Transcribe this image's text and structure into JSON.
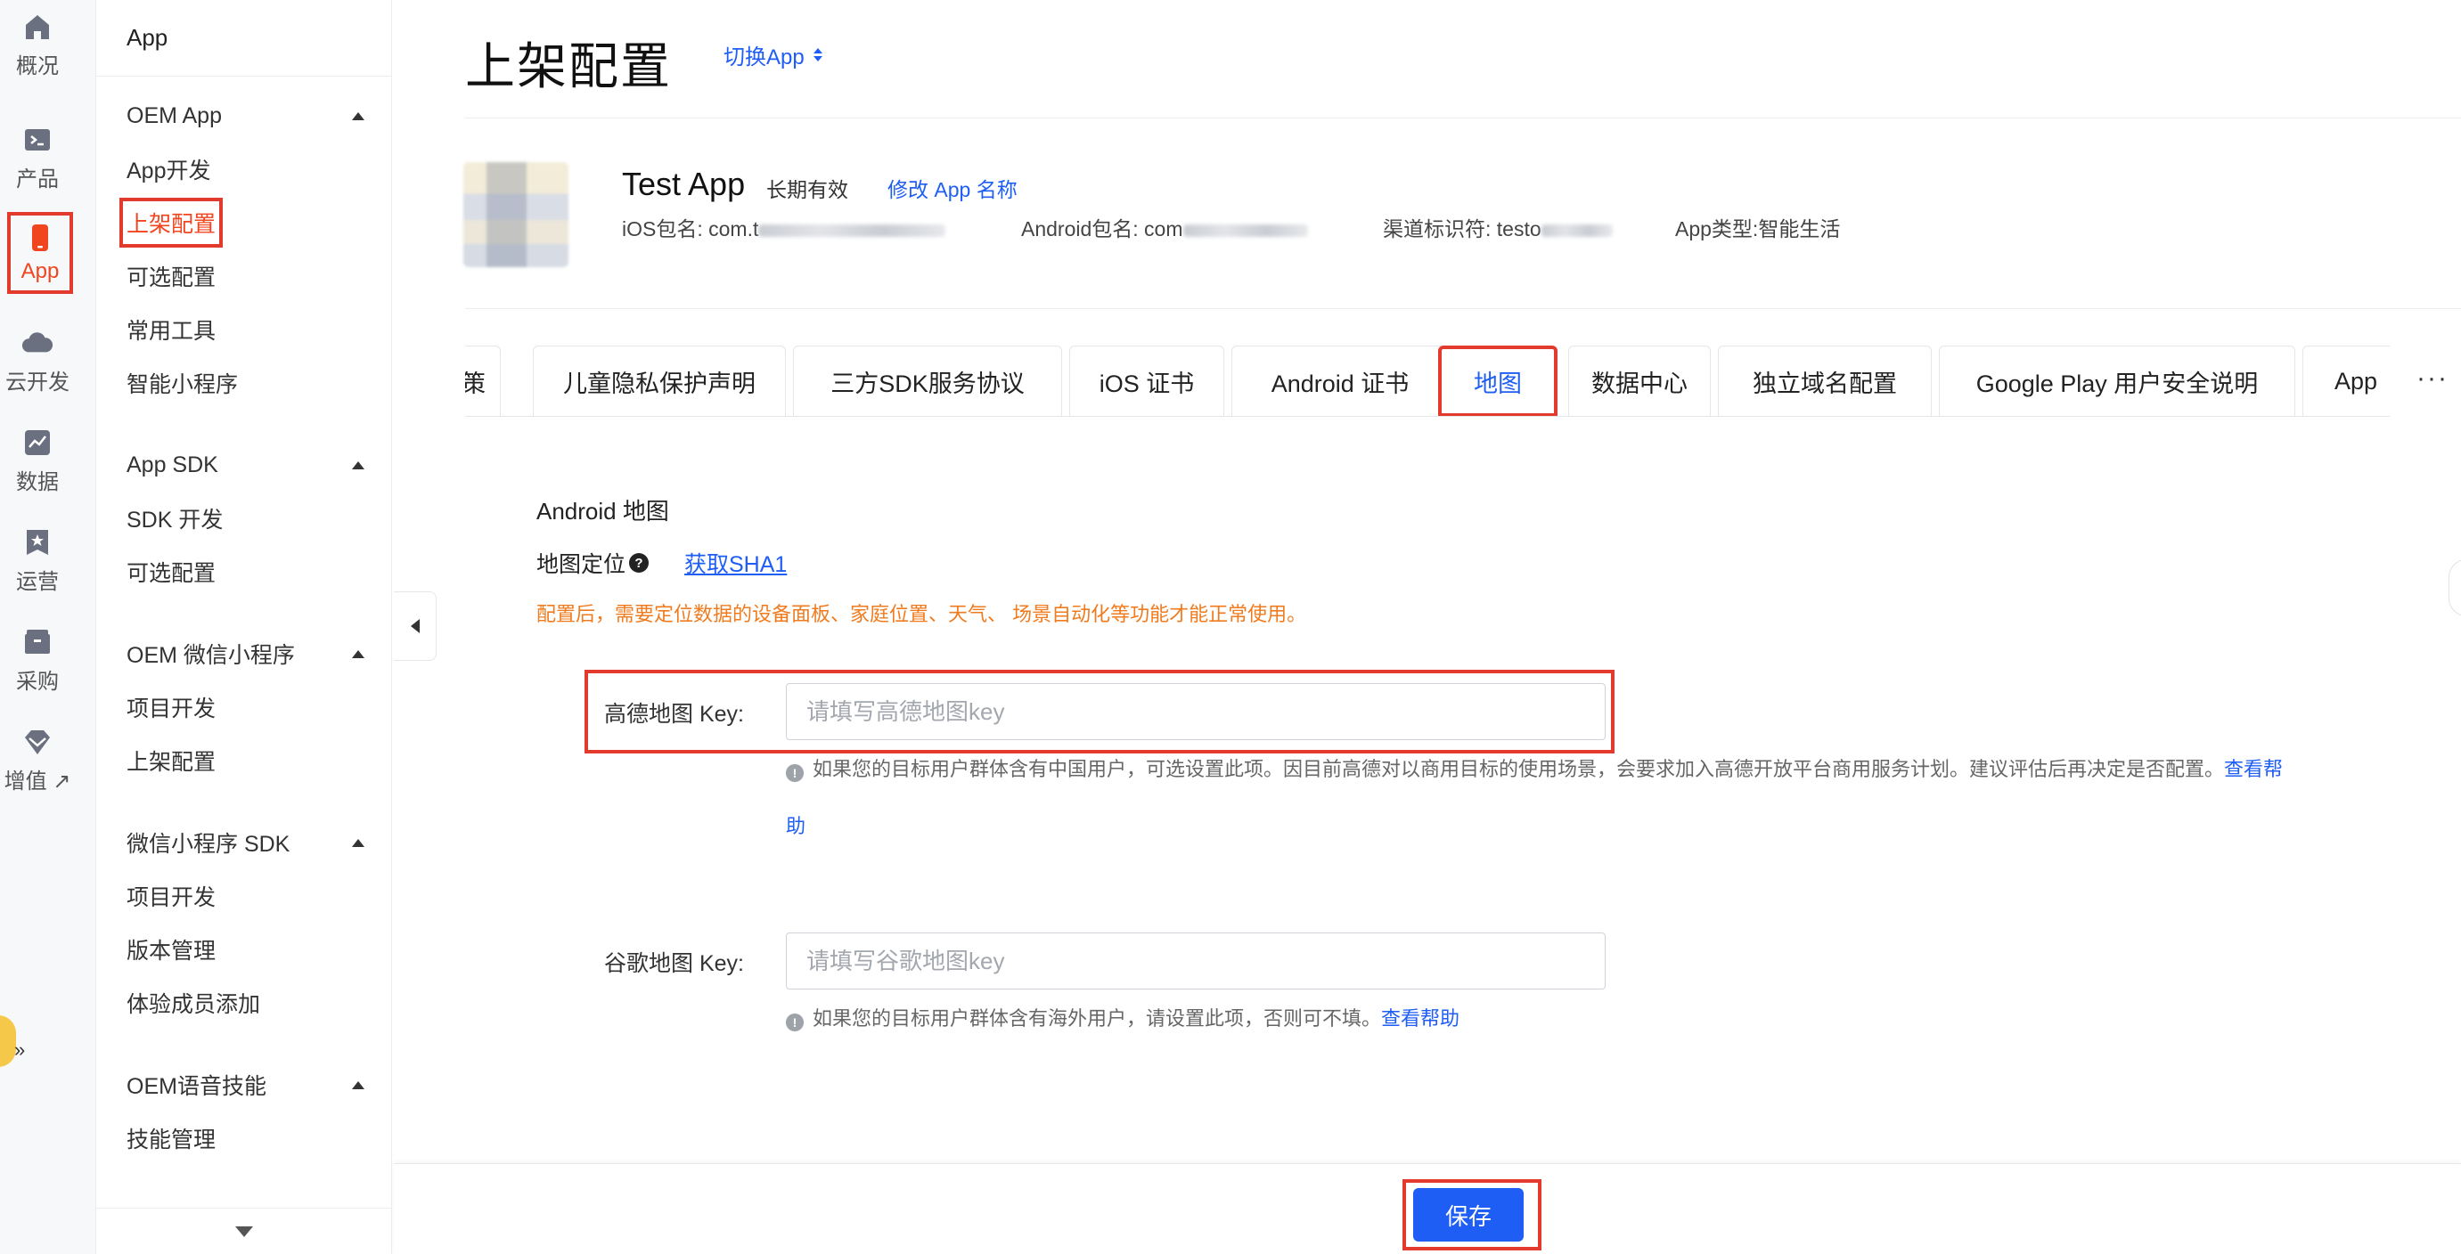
{
  "rail": {
    "items": [
      {
        "label": "概况",
        "icon": "home-icon"
      },
      {
        "label": "产品",
        "icon": "terminal-icon"
      },
      {
        "label": "App",
        "icon": "phone-icon"
      },
      {
        "label": "云开发",
        "icon": "cloud-icon"
      },
      {
        "label": "数据",
        "icon": "chart-icon"
      },
      {
        "label": "运营",
        "icon": "star-badge-icon"
      },
      {
        "label": "采购",
        "icon": "box-icon"
      },
      {
        "label": "增值 ↗",
        "icon": "gem-icon"
      }
    ],
    "active_index": 2,
    "accent": "#f0451f"
  },
  "menu": {
    "app_title": "App",
    "groups": [
      {
        "title": "OEM App",
        "items": [
          "App开发",
          "上架配置",
          "可选配置",
          "常用工具",
          "智能小程序"
        ]
      },
      {
        "title": "App SDK",
        "items": [
          "SDK 开发",
          "可选配置"
        ]
      },
      {
        "title": "OEM 微信小程序",
        "items": [
          "项目开发",
          "上架配置"
        ]
      },
      {
        "title": "微信小程序 SDK",
        "items": [
          "项目开发",
          "版本管理",
          "体验成员添加"
        ]
      },
      {
        "title": "OEM语音技能",
        "items": [
          "技能管理"
        ]
      }
    ],
    "active_item": "上架配置"
  },
  "header": {
    "title": "上架配置",
    "switch_label": "切换App"
  },
  "app_info": {
    "name": "Test App",
    "validity": "长期有效",
    "rename_link": "修改 App 名称",
    "ios_pkg": "iOS包名: com.t",
    "android_pkg": "Android包名: com",
    "channel": "渠道标识符: testo",
    "type": "App类型:智能生活"
  },
  "tabs": {
    "items": [
      "策",
      "儿童隐私保护声明",
      "三方SDK服务协议",
      "iOS 证书",
      "Android 证书",
      "地图",
      "数据中心",
      "独立域名配置",
      "Google Play 用户安全说明",
      "App"
    ],
    "active": "地图",
    "more": "···"
  },
  "form": {
    "section_title": "Android 地图",
    "location_label": "地图定位",
    "sha1_link": "获取SHA1",
    "warning": "配置后，需要定位数据的设备面板、家庭位置、天气、 场景自动化等功能才能正常使用。",
    "amap_label": "高德地图 Key:",
    "amap_placeholder": "请填写高德地图key",
    "amap_hint": "如果您的目标用户群体含有中国用户，可选设置此项。因目前高德对以商用目标的使用场景，会要求加入高德开放平台商用服务计划。建议评估后再决定是否配置。",
    "amap_help_a": "查看帮",
    "amap_help_b": "助",
    "google_label": "谷歌地图 Key:",
    "google_placeholder": "请填写谷歌地图key",
    "google_hint": "如果您的目标用户群体含有海外用户，请设置此项，否则可不填。",
    "google_help": "查看帮助"
  },
  "footer": {
    "save_label": "保存"
  },
  "colors": {
    "primary": "#1f5ef5",
    "warning": "#f07b1e",
    "highlight": "#e23b2e"
  }
}
